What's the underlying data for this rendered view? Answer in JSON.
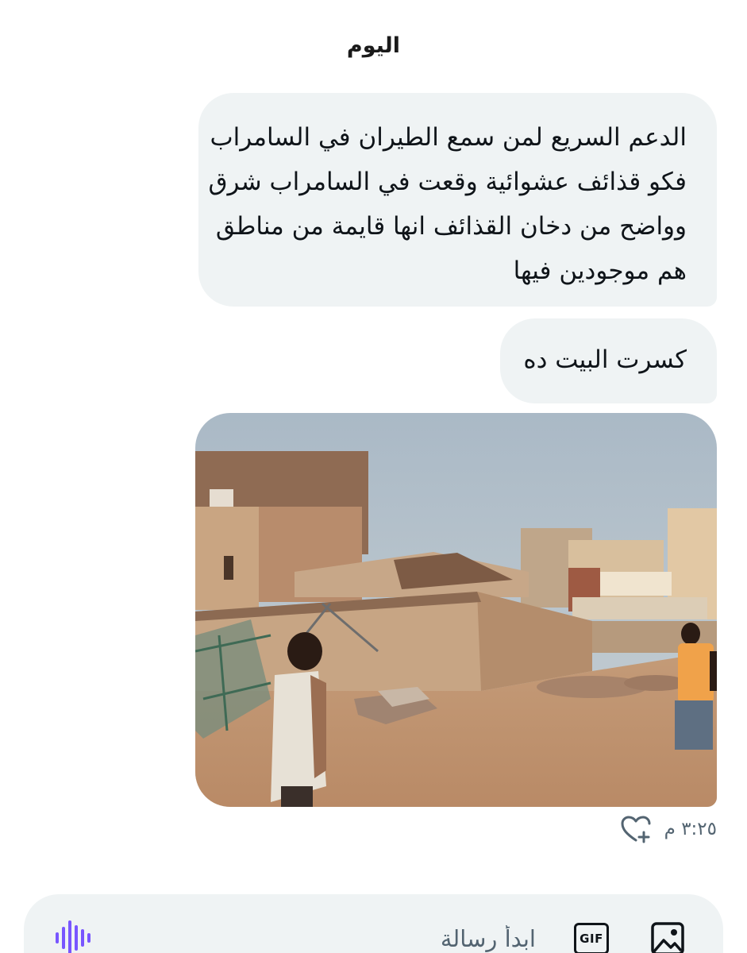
{
  "date_separator": "اليوم",
  "messages": [
    {
      "type": "text",
      "lines": [
        "الدعم السريع لمن سمع الطيران في السامراب",
        "فكو قذائف عشوائية وقعت في السامراب شرق",
        "وواضح من دخان القذائف انها قايمة من مناطق",
        "هم موجودين فيها"
      ]
    },
    {
      "type": "text",
      "lines": [
        "كسرت البيت ده"
      ]
    },
    {
      "type": "image",
      "icon": "photo-of-damaged-house"
    }
  ],
  "meta": {
    "timestamp": "٣:٢٥ م",
    "reaction_icon": "heart-plus-icon"
  },
  "composer": {
    "placeholder": "ابدأ رسالة",
    "gif_label": "GIF",
    "image_icon": "image-icon",
    "voice_icon": "voice-waveform-icon",
    "voice_color": "#7856ff"
  }
}
